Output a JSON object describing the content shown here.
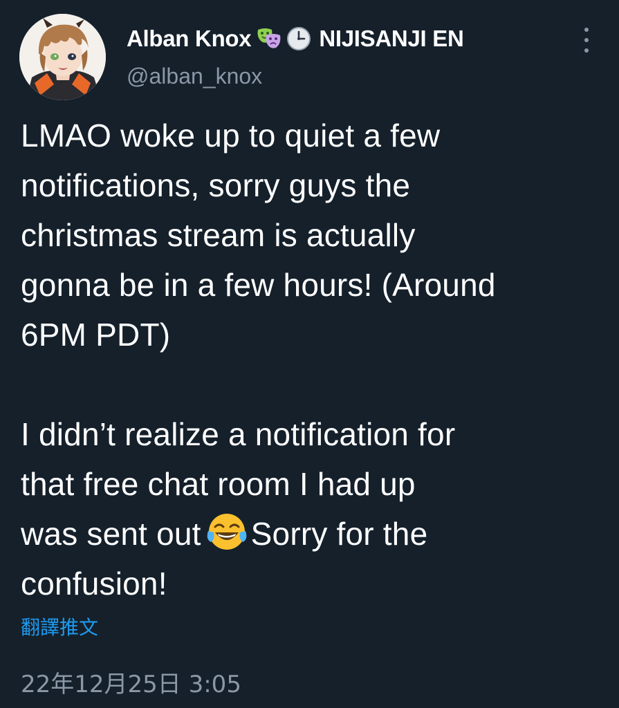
{
  "author": {
    "display_name": "Alban Knox",
    "badge_icons": [
      "performing-arts-icon",
      "clock-icon"
    ],
    "affiliation": "NIJISANJI EN",
    "handle": "@alban_knox"
  },
  "tweet": {
    "lines_paragraph_1": [
      "LMAO woke up to quiet a few",
      "notifications, sorry guys the",
      "christmas stream is actually",
      "gonna be in a few hours! (Around",
      "6PM PDT)"
    ],
    "lines_paragraph_2": [
      "I didn’t realize a notification for",
      "that free chat room I had up"
    ],
    "line_with_emoji_before": "was sent out",
    "emoji": "face-with-tears-of-joy-icon",
    "line_with_emoji_after": "Sorry for the",
    "last_line": "confusion!"
  },
  "translate_label": "翻譯推文",
  "timestamp": "22年12月25日 3:05",
  "colors": {
    "background": "#15202b",
    "text": "#ffffff",
    "secondary": "#8b98a5",
    "link": "#1d9bf0"
  }
}
